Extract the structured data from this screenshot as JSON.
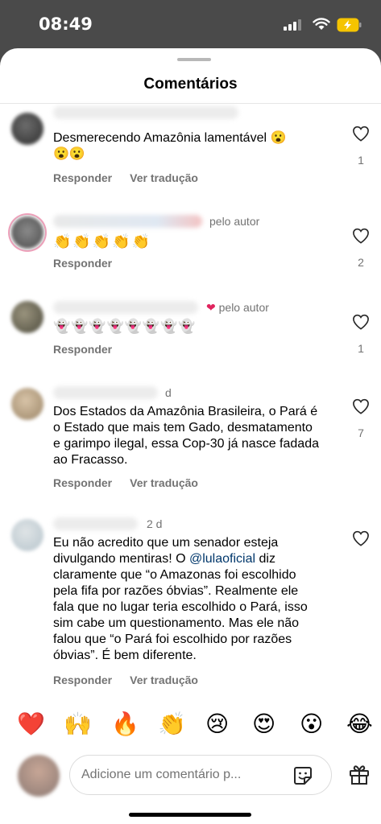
{
  "status_bar": {
    "time": "08:49"
  },
  "sheet": {
    "title": "Comentários"
  },
  "comments": [
    {
      "text": "Desmerecendo Amazônia lamentável 😮\n😮😮",
      "reply": "Responder",
      "translate": "Ver tradução",
      "likes": "1"
    },
    {
      "text": "👏👏👏👏👏",
      "by_author": "pelo autor",
      "reply": "Responder",
      "likes": "2"
    },
    {
      "text": "👻👻👻👻👻👻👻👻",
      "by_author": "pelo autor",
      "reply": "Responder",
      "likes": "1"
    },
    {
      "time": "d",
      "text": "Dos Estados da Amazônia Brasileira, o Pará é o Estado que mais tem Gado, desmatamento e garimpo ilegal, essa Cop-30 já nasce fadada ao Fracasso.",
      "reply": "Responder",
      "translate": "Ver tradução",
      "likes": "7"
    },
    {
      "time": "2 d",
      "text_before": "Eu não acredito que um senador esteja divulgando mentiras! O ",
      "mention": "@lulaoficial",
      "text_after": " diz claramente que “o Amazonas foi escolhido pela fifa por razões óbvias”. Realmente ele fala que no lugar teria escolhido o Pará, isso sim cabe um questionamento. Mas ele não falou que “o Pará foi escolhido por razões óbvias”. É bem diferente.",
      "reply": "Responder",
      "translate": "Ver tradução"
    }
  ],
  "reactions": [
    "❤️",
    "🙌",
    "🔥",
    "👏",
    "😢",
    "😍",
    "😮",
    "😂"
  ],
  "composer": {
    "placeholder": "Adicione um comentário p..."
  }
}
